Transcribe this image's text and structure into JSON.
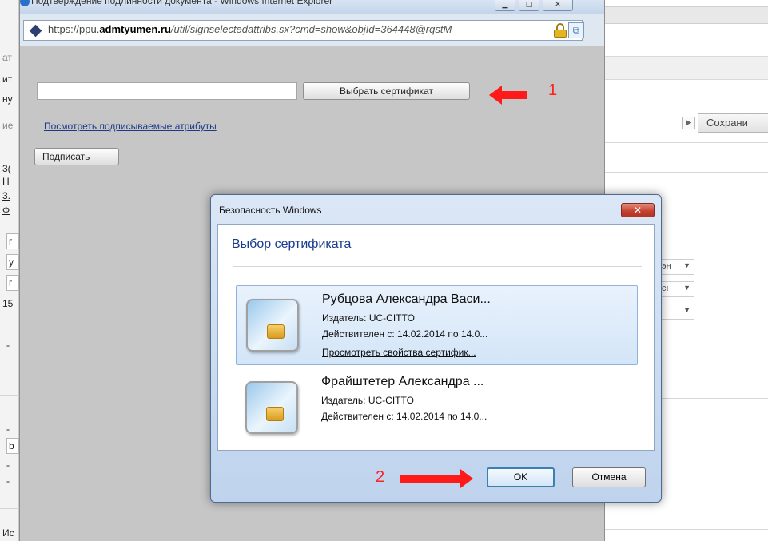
{
  "ie_window": {
    "title": "Подтверждение подлинности документа - Windows Internet Explorer",
    "url_prefix": "https://ppu.",
    "url_host": "admtyumen.ru",
    "url_path": "/util/signselectedattribs.sx?cmd=show&objId=364448@rqstM"
  },
  "sign_page": {
    "select_cert_label": "Выбрать сертификат",
    "view_attrs_link": "Посмотреть подписываемые атрибуты",
    "sign_label": "Подписать"
  },
  "annotations": {
    "one": "1",
    "two": "2",
    "color": "#ff1a1a"
  },
  "dialog": {
    "title": "Безопасность Windows",
    "heading": "Выбор сертификата",
    "certificates": [
      {
        "name": "Рубцова Александра Васи...",
        "issuer": "Издатель: UC-CITTO",
        "valid": "Действителен с: 14.02.2014 по 14.0...",
        "props_link": "Просмотреть свойства сертифик..."
      },
      {
        "name": "Фрайштетер Александра ...",
        "issuer": "Издатель: UC-CITTO",
        "valid": "Действителен с: 14.02.2014 по 14.0..."
      }
    ],
    "ok_label": "OK",
    "cancel_label": "Отмена",
    "close_symbol": "✕"
  },
  "background_page": {
    "save_label": "Сохрани",
    "left_fragments": [
      "ат",
      "ит",
      "ну",
      "ие",
      "3(",
      "Н",
      "3.",
      "Ф",
      "г",
      "у",
      "г",
      "15",
      "-",
      "-",
      "b",
      "-",
      "-",
      "Ис"
    ],
    "dropdowns": [
      "эн",
      "сı",
      ""
    ]
  },
  "colors": {
    "dialog_heading": "#1a3d8f",
    "link": "#1a3b8a"
  }
}
